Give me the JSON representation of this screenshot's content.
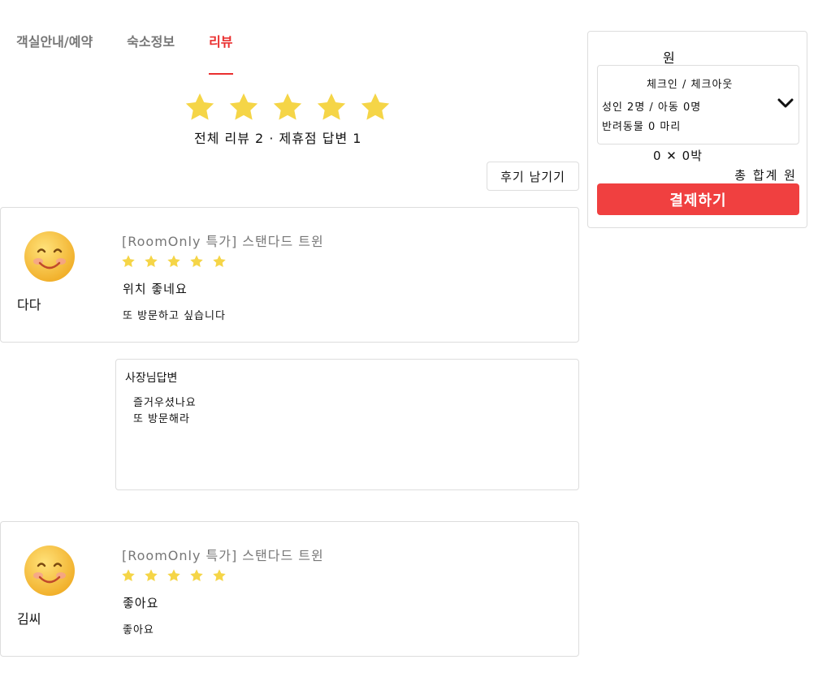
{
  "tabs": [
    {
      "label": "객실안내/예약",
      "active": false
    },
    {
      "label": "숙소정보",
      "active": false
    },
    {
      "label": "리뷰",
      "active": true
    }
  ],
  "rating": {
    "stars": 5,
    "summary": "전체 리뷰 2 · 제휴점 답변 1"
  },
  "write_review_label": "후기 남기기",
  "reviews": [
    {
      "author": "다다",
      "room": "[RoomOnly 특가] 스탠다드 트윈",
      "stars": 5,
      "title": "위치 좋네요",
      "body": "또 방문하고 싶습니다",
      "reply": {
        "heading": "사장님답변",
        "lines": [
          "즐거우셨나요",
          "또 방문해라"
        ]
      }
    },
    {
      "author": "김씨",
      "room": "[RoomOnly 특가] 스탠다드 트윈",
      "stars": 5,
      "title": "좋아요",
      "body": "좋아요"
    }
  ],
  "booking": {
    "price": "원",
    "dates": "체크인 / 체크아웃",
    "guests": "성인 2명 / 아동 0명",
    "pets": "반려동물 0 마리",
    "nights": "0 ✕ 0박",
    "total": "총 합계 원",
    "pay_label": "결제하기"
  },
  "colors": {
    "accent": "#ea2f2f",
    "pay_button": "#f04040",
    "star": "#f5d547",
    "border": "#dddddd"
  },
  "icons": {
    "star": "star-icon",
    "avatar": "smiley-face-icon",
    "dropdown": "chevron-down-icon"
  }
}
